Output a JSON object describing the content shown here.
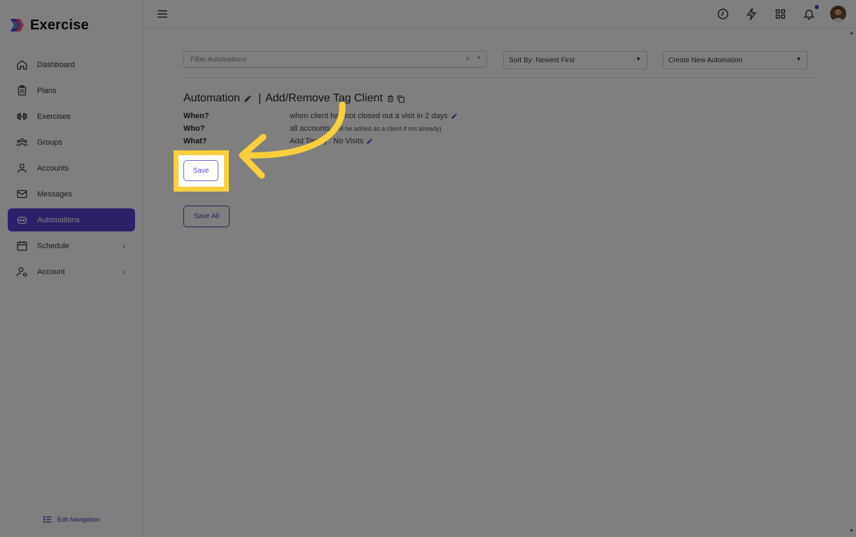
{
  "app": {
    "name": "Exercise"
  },
  "sidebar": {
    "items": [
      {
        "label": "Dashboard",
        "icon": "home-icon"
      },
      {
        "label": "Plans",
        "icon": "clipboard-icon"
      },
      {
        "label": "Exercises",
        "icon": "dumbbell-icon"
      },
      {
        "label": "Groups",
        "icon": "users-icon"
      },
      {
        "label": "Accounts",
        "icon": "user-icon"
      },
      {
        "label": "Messages",
        "icon": "mail-icon"
      },
      {
        "label": "Automations",
        "icon": "robot-icon",
        "active": true
      },
      {
        "label": "Schedule",
        "icon": "calendar-icon",
        "has_submenu": true
      },
      {
        "label": "Account",
        "icon": "user-settings-icon",
        "has_submenu": true
      }
    ],
    "edit_navigation": "Edit Navigation"
  },
  "topbar": {
    "icons": [
      "menu-icon",
      "clock-icon",
      "bolt-icon",
      "grid-icon",
      "bell-icon",
      "avatar"
    ],
    "notification_dot_color": "#5b3fd1"
  },
  "toolbar": {
    "filter_placeholder": "Filter Automations",
    "filter_clear": "×",
    "sort_label": "Sort By: Newest First",
    "create_label": "Create New Automation"
  },
  "automation": {
    "title_prefix": "Automation",
    "separator": "|",
    "name": "Add/Remove Tag Client",
    "when_label": "When?",
    "when_value": "when client has not closed out a visit in 2 days",
    "who_label": "Who?",
    "who_value": "all accounts",
    "who_note": "(will be added as a client if not already)",
    "what_label": "What?",
    "what_value": "Add Tag(s) : No Visits",
    "save_label": "Save",
    "save_all_label": "Save All"
  },
  "colors": {
    "accent": "#5b3fd1",
    "highlight": "#f9cf3e",
    "overlay": "rgba(0,0,0,0.5)"
  }
}
